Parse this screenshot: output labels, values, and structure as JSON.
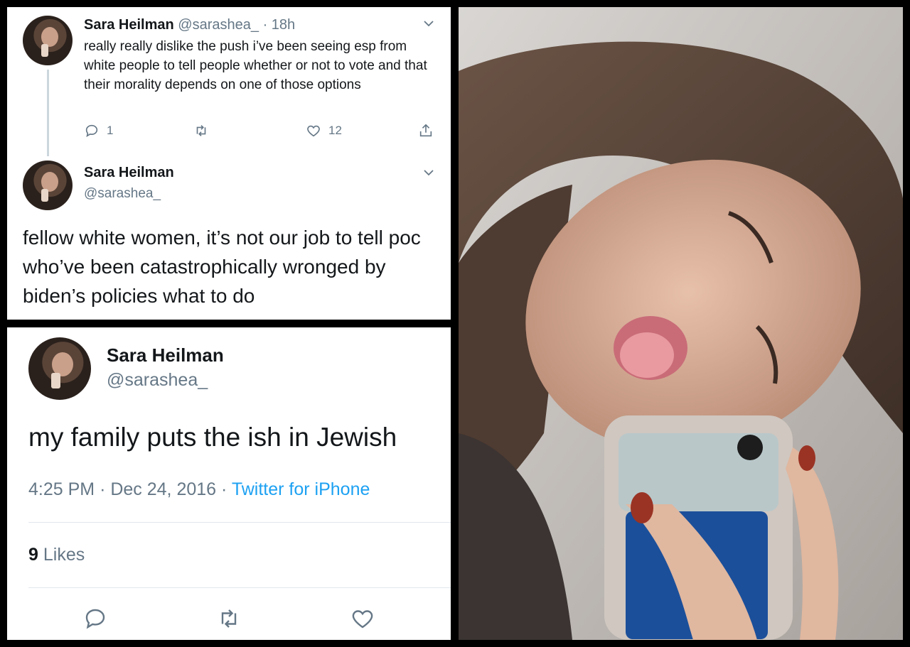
{
  "top_panel": {
    "tweet1": {
      "name": "Sara Heilman",
      "handle": "@sarashea_",
      "separator": "·",
      "time": "18h",
      "text": "really really dislike the push i’ve been seeing esp from white people to tell people whether or not to vote and that their morality depends on one of those options",
      "reply_count": "1",
      "like_count": "12"
    },
    "tweet2": {
      "name": "Sara Heilman",
      "handle": "@sarashea_",
      "text": "fellow white women, it’s not our job to tell poc who’ve been catastrophically wronged by biden’s policies what to do"
    }
  },
  "bottom_panel": {
    "name": "Sara Heilman",
    "handle": "@sarashea_",
    "text": "my family puts the ish in Jewish",
    "time": "4:25 PM",
    "dot1": "·",
    "date": "Dec 24, 2016",
    "dot2": "·",
    "source": "Twitter for iPhone",
    "likes_count": "9",
    "likes_label": "Likes"
  },
  "icons": {
    "reply": "reply-icon",
    "retweet": "retweet-icon",
    "like": "heart-icon",
    "share": "share-icon",
    "caret": "chevron-down-icon"
  },
  "colors": {
    "link": "#1da1f2",
    "muted": "#657786",
    "text": "#14171a",
    "thread_line": "#ccd6dd"
  }
}
